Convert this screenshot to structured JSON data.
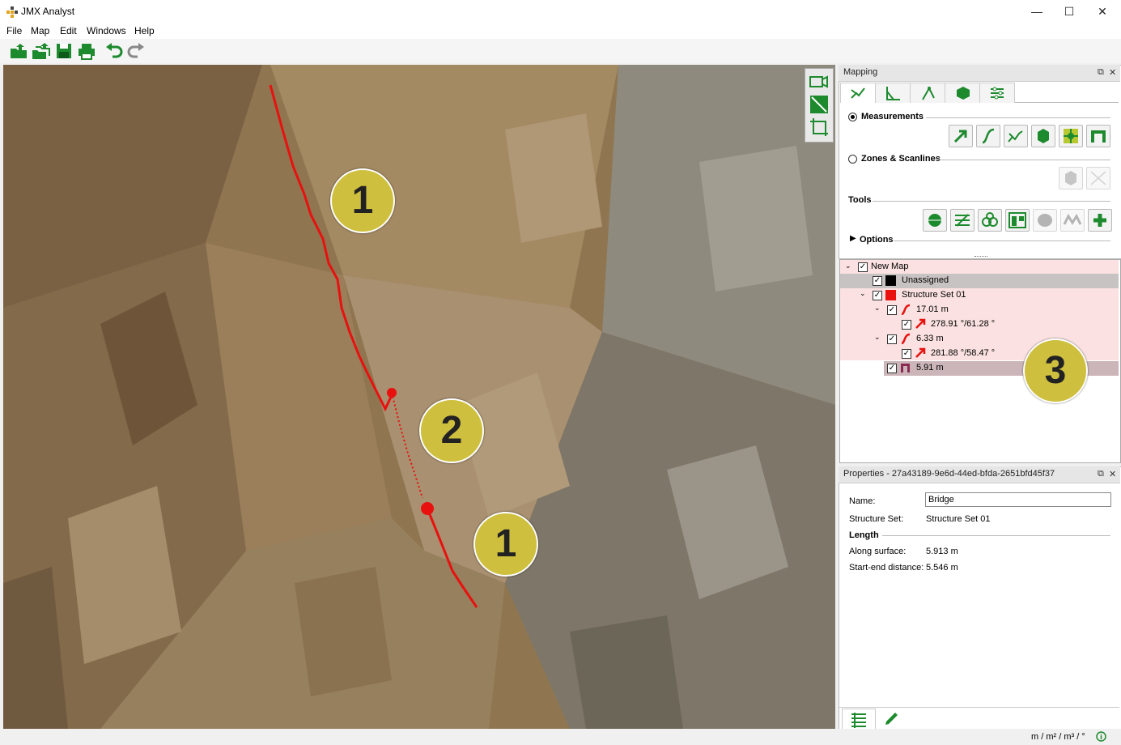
{
  "window": {
    "title": "JMX Analyst",
    "minimize": "—",
    "maximize": "☐",
    "close": "✕"
  },
  "menu": [
    "File",
    "Map",
    "Edit",
    "Windows",
    "Help"
  ],
  "toolbar_icons": [
    "open-folder-icon",
    "open-multiple-icon",
    "save-icon",
    "print-icon",
    "undo-icon",
    "redo-icon"
  ],
  "viewport": {
    "badges": [
      "1",
      "2",
      "1",
      "3"
    ],
    "view_tools": [
      "camera-icon",
      "fit-view-icon",
      "crop-view-icon"
    ]
  },
  "mapping": {
    "title": "Mapping",
    "tabs": [
      "trace-tab",
      "angle-tab",
      "points-tab",
      "polygon-tab",
      "settings-tab"
    ],
    "measurements_label": "Measurements",
    "measurement_tools": [
      "orientation-tool",
      "trace-tool",
      "structure-tool",
      "polygon-tool",
      "virtual-plane-tool",
      "bridge-tool"
    ],
    "zones_label": "Zones & Scanlines",
    "zone_tools": [
      "zone-tool",
      "scanline-tool"
    ],
    "tools_label": "Tools",
    "general_tools": [
      "mesh-tool",
      "profile-tool",
      "cluster-tool",
      "layout-tool",
      "sphere-tool",
      "wave-tool",
      "add-tool"
    ],
    "options_label": "Options"
  },
  "tree": {
    "root": "New Map",
    "unassigned": "Unassigned",
    "set": "Structure Set 01",
    "trace1": "17.01 m",
    "orient1": "278.91 °/61.28 °",
    "trace2": "6.33 m",
    "orient2": "281.88 °/58.47 °",
    "bridge": "5.91 m"
  },
  "properties": {
    "title": "Properties - 27a43189-9e6d-44ed-bfda-2651bfd45f37",
    "name_label": "Name:",
    "name_value": "Bridge",
    "set_label": "Structure Set:",
    "set_value": "Structure Set 01",
    "length_label": "Length",
    "along_label": "Along surface:",
    "along_value": "5.913 m",
    "startend_label": "Start-end distance:",
    "startend_value": "5.546 m"
  },
  "status": {
    "units": "m / m² / m³ / °"
  },
  "colors": {
    "accent_green": "#1e8a2e",
    "badge": "#cfbf3e",
    "trace_red": "#e8110f",
    "tree_pink": "#fbe1e1"
  }
}
